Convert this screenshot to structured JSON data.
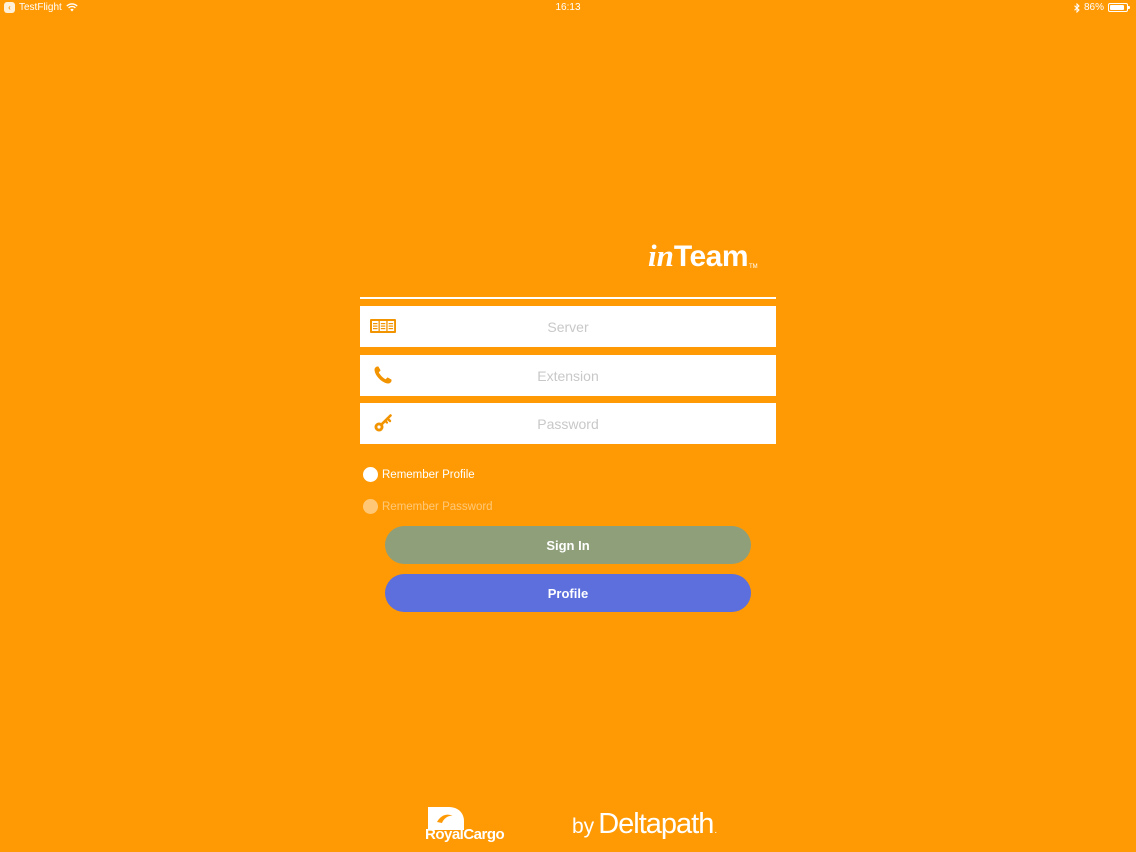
{
  "status_bar": {
    "back_app": "TestFlight",
    "time": "16:13",
    "battery": "86%",
    "battery_level": 0.86
  },
  "brand": {
    "logo_in": "in",
    "logo_team": "Team",
    "logo_tm": "TM"
  },
  "form": {
    "server_placeholder": "Server",
    "extension_placeholder": "Extension",
    "password_placeholder": "Password",
    "remember_profile": "Remember Profile",
    "remember_password": "Remember Password"
  },
  "buttons": {
    "sign_in": "Sign In",
    "profile": "Profile"
  },
  "footer": {
    "partner_logo": "RoyalCargo",
    "by": "by",
    "company": "Deltapath",
    "company_dot": "."
  },
  "colors": {
    "background": "#FF9A05",
    "sign_in_button": "#8F9F79",
    "profile_button": "#5C6FDC",
    "icon": "#F29300"
  },
  "icons": {
    "server": "server-rack-icon",
    "extension": "phone-icon",
    "password": "key-icon",
    "wifi": "wifi-icon",
    "bluetooth": "bluetooth-icon",
    "battery": "battery-icon"
  }
}
